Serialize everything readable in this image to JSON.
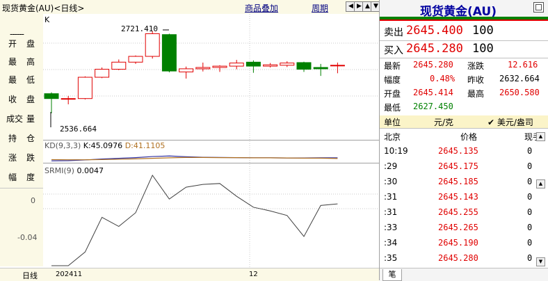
{
  "topbar": {
    "title": "现货黄金(AU)<日线>",
    "overlay_label": "商品叠加",
    "period_label": "周期",
    "nav_icons": [
      "arrow-left-icon",
      "arrow-right-icon",
      "zoom-in-icon",
      "zoom-out-icon"
    ]
  },
  "leftpanel": {
    "dashes": "------",
    "labels": [
      [
        "开",
        "盘"
      ],
      [
        "最",
        "高"
      ],
      [
        "最",
        "低"
      ],
      [
        "收",
        "盘"
      ],
      [
        "成交",
        "量"
      ],
      [
        "持",
        "仓"
      ],
      [
        "涨",
        "跌"
      ],
      [
        "幅",
        "度"
      ]
    ],
    "footer": "日线"
  },
  "chart": {
    "k_label": "K",
    "max_label": "2721.410",
    "min_label": "2536.664",
    "kd_title": "KD(9,3,3)",
    "kd_k": "K:45.0976",
    "kd_d": "D:41.1105",
    "smi_title": "SRMI(9)",
    "smi_value": "0.0047",
    "y_labels": [
      "0",
      "-0.04"
    ],
    "x_labels": [
      "202411",
      "12"
    ]
  },
  "chart_data": {
    "type": "candlestick",
    "title": "现货黄金(AU)<日线>",
    "candles": [
      {
        "open": 2581,
        "high": 2584,
        "low": 2537,
        "close": 2570
      },
      {
        "open": 2569,
        "high": 2576,
        "low": 2557,
        "close": 2570
      },
      {
        "open": 2570,
        "high": 2620,
        "low": 2568,
        "close": 2618
      },
      {
        "open": 2618,
        "high": 2640,
        "low": 2616,
        "close": 2636
      },
      {
        "open": 2636,
        "high": 2658,
        "low": 2634,
        "close": 2652
      },
      {
        "open": 2652,
        "high": 2667,
        "low": 2648,
        "close": 2665
      },
      {
        "open": 2665,
        "high": 2721.41,
        "low": 2660,
        "close": 2716
      },
      {
        "open": 2714,
        "high": 2716,
        "low": 2629,
        "close": 2632
      },
      {
        "open": 2630,
        "high": 2642,
        "low": 2615,
        "close": 2637
      },
      {
        "open": 2637,
        "high": 2651,
        "low": 2631,
        "close": 2640
      },
      {
        "open": 2640,
        "high": 2645,
        "low": 2630,
        "close": 2643
      },
      {
        "open": 2643,
        "high": 2657,
        "low": 2636,
        "close": 2650
      },
      {
        "open": 2652,
        "high": 2656,
        "low": 2628,
        "close": 2643
      },
      {
        "open": 2643,
        "high": 2650,
        "low": 2640,
        "close": 2646
      },
      {
        "open": 2645,
        "high": 2654,
        "low": 2641,
        "close": 2650
      },
      {
        "open": 2651,
        "high": 2653,
        "low": 2630,
        "close": 2636
      },
      {
        "open": 2640,
        "high": 2648,
        "low": 2621,
        "close": 2637
      },
      {
        "open": 2645,
        "high": 2651,
        "low": 2627,
        "close": 2645
      }
    ],
    "kd": {
      "k": [
        28,
        29,
        33,
        38,
        42,
        46,
        52,
        55,
        51,
        48,
        47,
        46,
        45,
        45,
        44,
        44,
        45,
        45.0976
      ],
      "d": [
        35,
        34,
        34,
        35,
        37,
        39,
        42,
        45,
        47,
        47,
        46,
        46,
        45,
        45,
        44,
        43,
        43,
        41.1105
      ]
    },
    "srmi": [
      -0.063,
      -0.063,
      -0.048,
      -0.01,
      -0.02,
      -0.005,
      0.036,
      0.01,
      0.023,
      0.026,
      0.027,
      0.013,
      0.001,
      -0.003,
      -0.008,
      -0.031,
      0.003,
      0.0047
    ],
    "srmi_ylim": [
      -0.063,
      0.036
    ],
    "x_tick_labels": [
      "202411",
      "12"
    ]
  },
  "quote": {
    "title": "现货黄金(AU)",
    "sell_label": "卖出",
    "sell_price": "2645.400",
    "sell_qty": "100",
    "buy_label": "买入",
    "buy_price": "2645.280",
    "buy_qty": "100",
    "stats": [
      {
        "l1": "最新",
        "v1": "2645.280",
        "l2": "涨跌",
        "v2": "12.616"
      },
      {
        "l1": "幅度",
        "v1": "0.48%",
        "l2": "昨收",
        "v2": "2632.664"
      },
      {
        "l1": "开盘",
        "v1": "2645.414",
        "l2": "最高",
        "v2": "2650.580"
      },
      {
        "l1": "最低",
        "v1": "2627.450",
        "l2": "",
        "v2": ""
      }
    ],
    "unit_label": "单位",
    "unit_value": "元/克",
    "currency_option": "美元/盎司",
    "ticks_header": {
      "time": "北京",
      "price": "价格",
      "qty": "现手"
    },
    "ticks": [
      {
        "time": "10:19",
        "price": "2645.135",
        "qty": "0"
      },
      {
        "time": ":29",
        "price": "2645.175",
        "qty": "0"
      },
      {
        "time": ":30",
        "price": "2645.185",
        "qty": "0"
      },
      {
        "time": ":31",
        "price": "2645.143",
        "qty": "0"
      },
      {
        "time": ":31",
        "price": "2645.255",
        "qty": "0"
      },
      {
        "time": ":33",
        "price": "2645.265",
        "qty": "0"
      },
      {
        "time": ":34",
        "price": "2645.190",
        "qty": "0"
      },
      {
        "time": ":35",
        "price": "2645.280",
        "qty": "0"
      }
    ],
    "tab_label": "笔"
  },
  "colors": {
    "up": "#e00000",
    "down": "#008000",
    "kd_k": "#3030a0",
    "kd_d": "#b07020",
    "header_bg": "#fbf9e6"
  }
}
